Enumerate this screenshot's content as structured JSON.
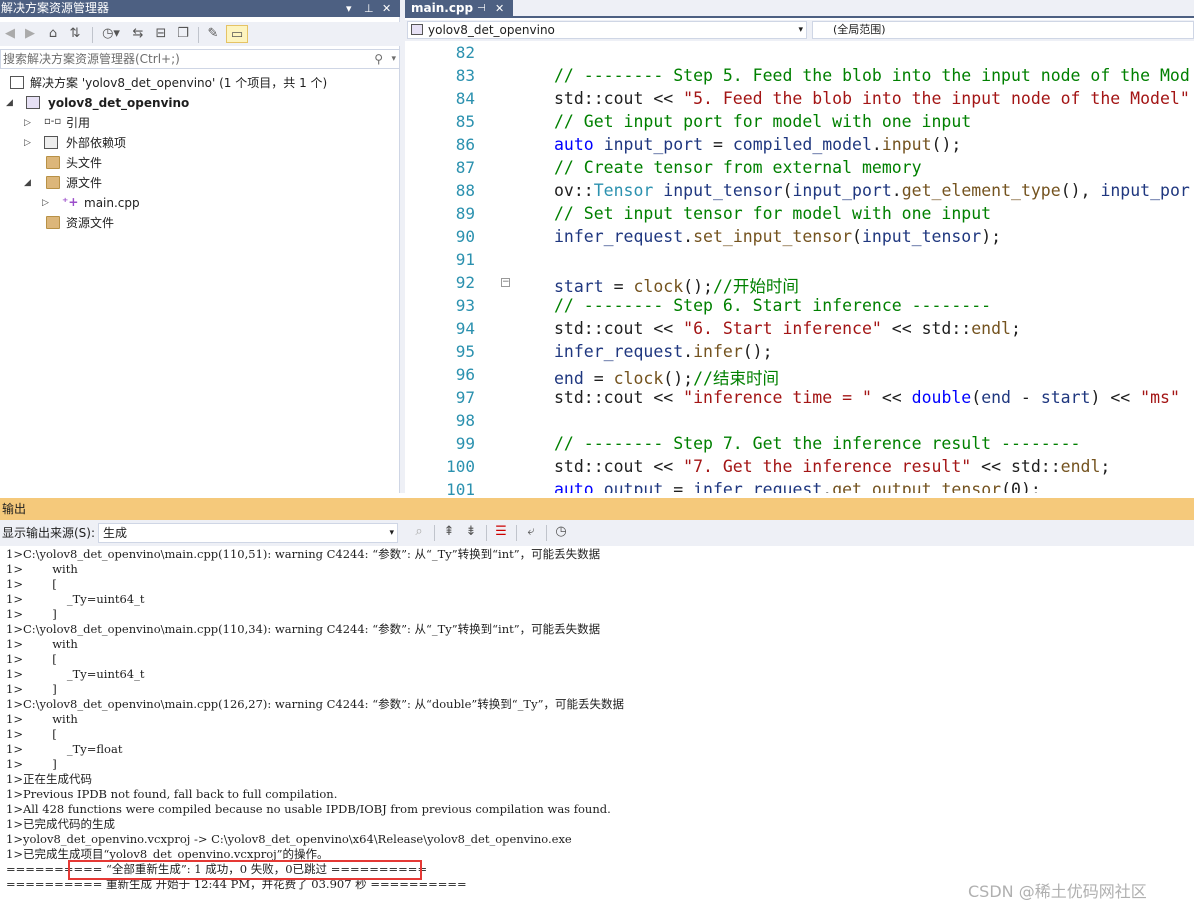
{
  "solution_explorer": {
    "title": "解决方案资源管理器",
    "search_placeholder": "搜索解决方案资源管理器(Ctrl+;)",
    "solution_label": "解决方案 'yolov8_det_openvino' (1 个项目，共 1 个)",
    "project_label": "yolov8_det_openvino",
    "items": [
      {
        "label": "引用",
        "icon": "references-icon"
      },
      {
        "label": "外部依赖项",
        "icon": "external-deps-icon"
      },
      {
        "label": "头文件",
        "icon": "folder-icon"
      },
      {
        "label": "源文件",
        "icon": "folder-icon"
      },
      {
        "label": "main.cpp",
        "icon": "cpp-file-icon"
      },
      {
        "label": "资源文件",
        "icon": "folder-icon"
      }
    ]
  },
  "editor": {
    "tab_label": "main.cpp",
    "nav_project": "yolov8_det_openvino",
    "nav_scope": "(全局范围)",
    "lines": [
      {
        "n": "82",
        "html": ""
      },
      {
        "n": "83",
        "html": "<span class='cm'>// -------- Step 5. Feed the blob into the input node of the Mod</span>"
      },
      {
        "n": "84",
        "html": "std::cout &lt;&lt; <span class='st'>\"5. Feed the blob into the input node of the Model\"</span>"
      },
      {
        "n": "85",
        "html": "<span class='cm'>// Get input port for model with one input</span>"
      },
      {
        "n": "86",
        "html": "<span class='kw'>auto</span> <span class='vr'>input_port</span> = <span class='vr'>compiled_model</span>.<span class='fn'>input</span>();"
      },
      {
        "n": "87",
        "html": "<span class='cm'>// Create tensor from external memory</span>"
      },
      {
        "n": "88",
        "html": "ov::<span class='ty'>Tensor</span> <span class='vr'>input_tensor</span>(<span class='vr'>input_port</span>.<span class='fn'>get_element_type</span>(), <span class='vr'>input_por</span>"
      },
      {
        "n": "89",
        "html": "<span class='cm'>// Set input tensor for model with one input</span>"
      },
      {
        "n": "90",
        "html": "<span class='vr'>infer_request</span>.<span class='fn'>set_input_tensor</span>(<span class='vr'>input_tensor</span>);"
      },
      {
        "n": "91",
        "html": ""
      },
      {
        "n": "92",
        "html": "<span class='vr'>start</span> = <span class='fn'>clock</span>();<span class='cm'>//开始时间</span>"
      },
      {
        "n": "93",
        "html": "<span class='cm'>// -------- Step 6. Start inference --------</span>"
      },
      {
        "n": "94",
        "html": "std::cout &lt;&lt; <span class='st'>\"6. Start inference\"</span> &lt;&lt; std::<span class='fn'>endl</span>;"
      },
      {
        "n": "95",
        "html": "<span class='vr'>infer_request</span>.<span class='fn'>infer</span>();"
      },
      {
        "n": "96",
        "html": "<span class='vr'>end</span> = <span class='fn'>clock</span>();<span class='cm'>//结束时间</span>"
      },
      {
        "n": "97",
        "html": "std::cout &lt;&lt; <span class='st'>\"inference time = \"</span> &lt;&lt; <span class='kw'>double</span>(<span class='vr'>end</span> - <span class='vr'>start</span>) &lt;&lt; <span class='st'>\"ms\"</span>"
      },
      {
        "n": "98",
        "html": ""
      },
      {
        "n": "99",
        "html": "<span class='cm'>// -------- Step 7. Get the inference result --------</span>"
      },
      {
        "n": "100",
        "html": "std::cout &lt;&lt; <span class='st'>\"7. Get the inference result\"</span> &lt;&lt; std::<span class='fn'>endl</span>;"
      },
      {
        "n": "101",
        "html": "<span class='kw'>auto</span> <span class='vr'>output</span> = <span class='vr'>infer_request</span>.<span class='fn'>get_output_tensor</span>(0);"
      }
    ]
  },
  "output": {
    "title": "输出",
    "source_label": "显示输出来源(S):",
    "source_value": "生成",
    "lines": [
      "1>C:\\yolov8_det_openvino\\main.cpp(110,51): warning C4244: “参数”: 从“_Ty”转换到“int”，可能丢失数据",
      "1>        with",
      "1>        [",
      "1>            _Ty=uint64_t",
      "1>        ]",
      "1>C:\\yolov8_det_openvino\\main.cpp(110,34): warning C4244: “参数”: 从“_Ty”转换到“int”，可能丢失数据",
      "1>        with",
      "1>        [",
      "1>            _Ty=uint64_t",
      "1>        ]",
      "1>C:\\yolov8_det_openvino\\main.cpp(126,27): warning C4244: “参数”: 从“double”转换到“_Ty”，可能丢失数据",
      "1>        with",
      "1>        [",
      "1>            _Ty=float",
      "1>        ]",
      "1>正在生成代码",
      "1>Previous IPDB not found, fall back to full compilation.",
      "1>All 428 functions were compiled because no usable IPDB/IOBJ from previous compilation was found.",
      "1>已完成代码的生成",
      "1>yolov8_det_openvino.vcxproj -> C:\\yolov8_det_openvino\\x64\\Release\\yolov8_det_openvino.exe",
      "1>已完成生成项目“yolov8_det_openvino.vcxproj”的操作。",
      "========== “全部重新生成”: 1 成功，0 失败，0已跳过 ==========",
      "========== 重新生成 开始于 12:44 PM，并花费了 03.907 秒 =========="
    ]
  },
  "watermark": "CSDN @稀土优码网社区",
  "colors": {
    "accent": "#4d6082",
    "output_title_bg": "#f5c97b",
    "highlight_box": "#e53935"
  }
}
